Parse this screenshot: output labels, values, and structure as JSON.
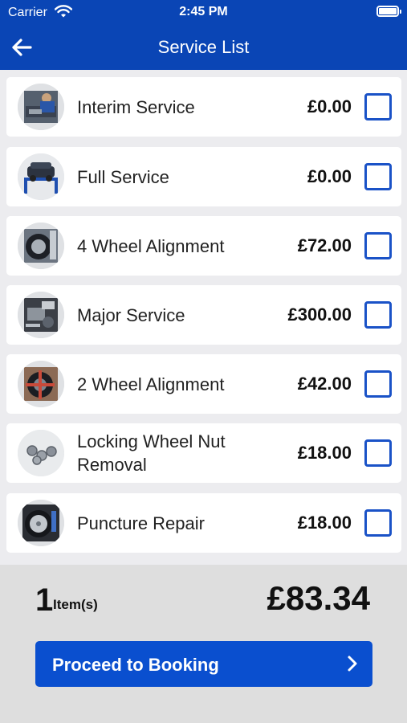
{
  "status_bar": {
    "carrier": "Carrier",
    "time": "2:45 PM"
  },
  "nav": {
    "title": "Service List",
    "back_icon": "arrow-left-icon"
  },
  "services": [
    {
      "name": "Interim Service",
      "price": "£0.00",
      "checked": false,
      "thumb_icon": "mechanic-photo"
    },
    {
      "name": "Full Service",
      "price": "£0.00",
      "checked": false,
      "thumb_icon": "car-lift-photo"
    },
    {
      "name": "4 Wheel Alignment",
      "price": "£72.00",
      "checked": false,
      "thumb_icon": "wheel-photo"
    },
    {
      "name": "Major Service",
      "price": "£300.00",
      "checked": false,
      "thumb_icon": "engine-bay-photo"
    },
    {
      "name": "2 Wheel Alignment",
      "price": "£42.00",
      "checked": false,
      "thumb_icon": "wheel-clamp-photo"
    },
    {
      "name": "Locking Wheel Nut Removal",
      "price": "£18.00",
      "checked": false,
      "thumb_icon": "wheel-nuts-photo"
    },
    {
      "name": "Puncture Repair",
      "price": "£18.00",
      "checked": false,
      "thumb_icon": "tyre-repair-photo"
    }
  ],
  "summary": {
    "count": "1",
    "count_label": "Item(s)",
    "total": "£83.34"
  },
  "proceed_button": {
    "label": "Proceed to Booking",
    "icon": "chevron-right-icon"
  },
  "colors": {
    "header": "#0a45b5",
    "button": "#0a4fcf",
    "checkbox": "#1a52c7",
    "background": "#ececef",
    "footer": "#dedede"
  }
}
